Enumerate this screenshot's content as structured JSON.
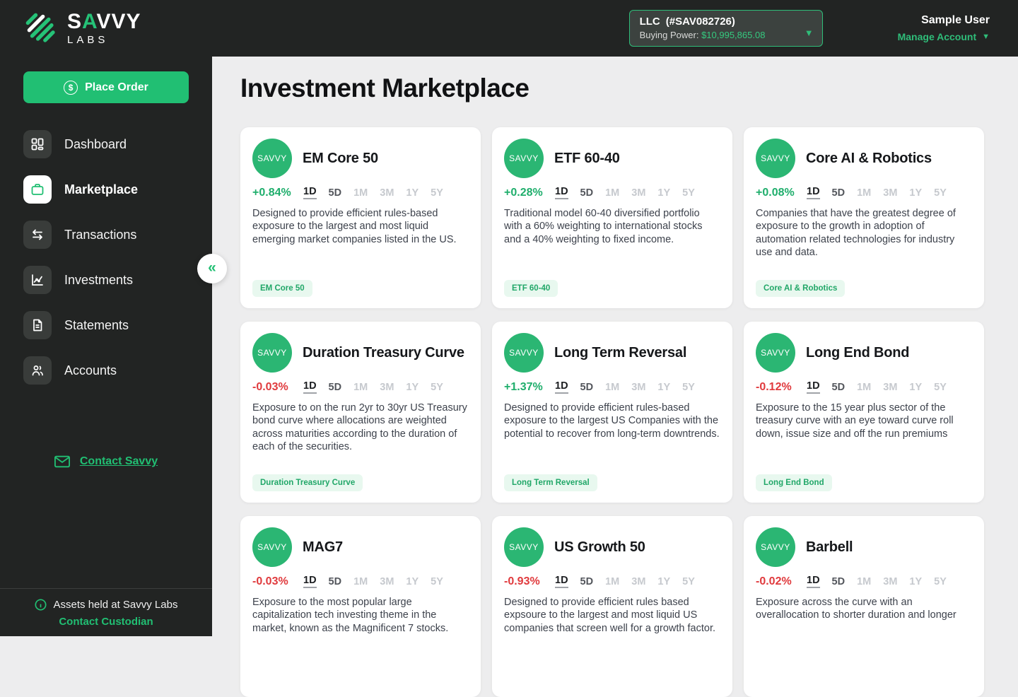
{
  "brand": {
    "name_prefix": "S",
    "name_accent": "A",
    "name_suffix": "VVY",
    "sub": "LABS"
  },
  "topbar": {
    "account_chip": {
      "entity": "LLC",
      "account_id": "(#SAV082726)",
      "buying_power_label": "Buying Power:",
      "buying_power_value": "$10,995,865.08"
    },
    "user": {
      "name": "Sample User",
      "manage_label": "Manage Account"
    }
  },
  "sidebar": {
    "place_order_label": "Place Order",
    "items": [
      {
        "label": "Dashboard",
        "icon": "dashboard-icon",
        "active": false
      },
      {
        "label": "Marketplace",
        "icon": "briefcase-icon",
        "active": true
      },
      {
        "label": "Transactions",
        "icon": "transfer-arrows-icon",
        "active": false
      },
      {
        "label": "Investments",
        "icon": "chart-line-icon",
        "active": false
      },
      {
        "label": "Statements",
        "icon": "document-icon",
        "active": false
      },
      {
        "label": "Accounts",
        "icon": "people-icon",
        "active": false
      }
    ],
    "contact_link": "Contact Savvy",
    "footer": {
      "line1": "Assets held at Savvy Labs",
      "line2": "Contact Custodian"
    }
  },
  "main": {
    "title": "Investment Marketplace",
    "avatar_label": "SAVVY",
    "ranges": [
      "1D",
      "5D",
      "1M",
      "3M",
      "1Y",
      "5Y"
    ],
    "active_range": "1D",
    "enabled_ranges": [
      "1D",
      "5D"
    ],
    "cards": [
      {
        "name": "EM Core 50",
        "change": "+0.84%",
        "direction": "up",
        "description": "Designed to provide efficient rules-based exposure to the largest and most liquid emerging market companies listed in the US.",
        "tag": "EM Core 50"
      },
      {
        "name": "ETF 60-40",
        "change": "+0.28%",
        "direction": "up",
        "description": "Traditional model 60-40 diversified portfolio with a 60% weighting to international stocks and a 40% weighting to fixed income.",
        "tag": "ETF 60-40"
      },
      {
        "name": "Core AI & Robotics",
        "change": "+0.08%",
        "direction": "up",
        "description": "Companies that have the greatest degree of exposure to the growth in adoption of automation related technologies for industry use and data.",
        "tag": "Core AI & Robotics"
      },
      {
        "name": "Duration Treasury Curve",
        "change": "-0.03%",
        "direction": "down",
        "description": "Exposure to on the run 2yr to 30yr US Treasury bond curve where allocations are weighted across maturities according to the duration of each of the securities.",
        "tag": "Duration Treasury Curve"
      },
      {
        "name": "Long Term Reversal",
        "change": "+1.37%",
        "direction": "up",
        "description": "Designed to provide efficient rules-based exposure to the largest US Companies with the potential to recover from long-term downtrends.",
        "tag": "Long Term Reversal"
      },
      {
        "name": "Long End Bond",
        "change": "-0.12%",
        "direction": "down",
        "description": "Exposure to the 15 year plus sector of the treasury curve with an eye toward curve roll down, issue size and off the run premiums",
        "tag": "Long End Bond"
      },
      {
        "name": "MAG7",
        "change": "-0.03%",
        "direction": "down",
        "description": "Exposure to the most popular large capitalization tech investing theme in the market, known as the Magnificent 7 stocks.",
        "tag": null
      },
      {
        "name": "US Growth 50",
        "change": "-0.93%",
        "direction": "down",
        "description": "Designed to provide efficient rules based expsoure to the largest and most liquid US companies that screen well for a growth factor.",
        "tag": null
      },
      {
        "name": "Barbell",
        "change": "-0.02%",
        "direction": "down",
        "description": "Exposure across the curve with an overallocation to shorter duration and longer",
        "tag": null
      }
    ]
  },
  "colors": {
    "accent_green": "#21bf73",
    "up_green": "#1fae6c",
    "down_red": "#e03a3d",
    "tag_bg": "#e8f8ef",
    "dark_bg": "#222423",
    "main_bg": "#ededee"
  }
}
